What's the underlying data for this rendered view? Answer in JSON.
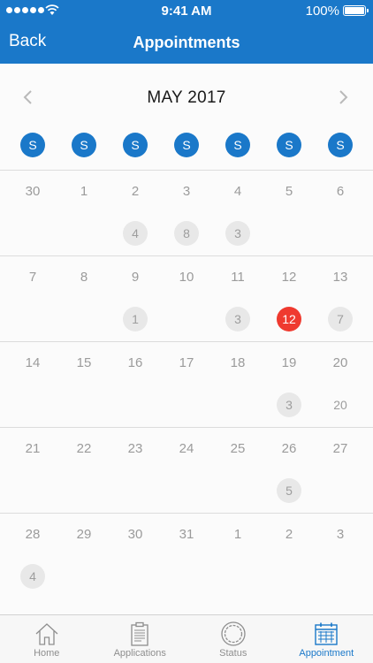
{
  "status_bar": {
    "time": "9:41 AM",
    "battery": "100%"
  },
  "nav": {
    "back_label": "Back",
    "title": "Appointments"
  },
  "calendar": {
    "month_label": "MAY 2017",
    "weekday_labels": [
      "S",
      "S",
      "S",
      "S",
      "S",
      "S",
      "S"
    ],
    "weeks": [
      {
        "days": [
          "30",
          "1",
          "2",
          "3",
          "4",
          "5",
          "6"
        ],
        "badges": [
          "",
          "",
          "4",
          "8",
          "3",
          "",
          ""
        ]
      },
      {
        "days": [
          "7",
          "8",
          "9",
          "10",
          "11",
          "12",
          "13"
        ],
        "badges": [
          "",
          "",
          "1",
          "",
          "3",
          "12",
          "7"
        ]
      },
      {
        "days": [
          "14",
          "15",
          "16",
          "17",
          "18",
          "19",
          "20"
        ],
        "badges": [
          "",
          "",
          "",
          "",
          "",
          "3",
          "20"
        ]
      },
      {
        "days": [
          "21",
          "22",
          "23",
          "24",
          "25",
          "26",
          "27"
        ],
        "badges": [
          "",
          "",
          "",
          "",
          "",
          "5",
          ""
        ]
      },
      {
        "days": [
          "28",
          "29",
          "30",
          "31",
          "1",
          "2",
          "3"
        ],
        "badges": [
          "4",
          "",
          "",
          "",
          "",
          "",
          ""
        ]
      }
    ],
    "highlight": {
      "week": 1,
      "col": 5
    },
    "plain_badges": [
      {
        "week": 2,
        "col": 6
      }
    ]
  },
  "tabs": [
    {
      "label": "Home",
      "icon": "home-icon"
    },
    {
      "label": "Applications",
      "icon": "clipboard-icon"
    },
    {
      "label": "Status",
      "icon": "status-ring-icon"
    },
    {
      "label": "Appointment",
      "icon": "calendar-icon",
      "active": true
    }
  ],
  "colors": {
    "brand": "#1a78c9",
    "today": "#ef3a2f",
    "badge": "#e8e8e8"
  }
}
